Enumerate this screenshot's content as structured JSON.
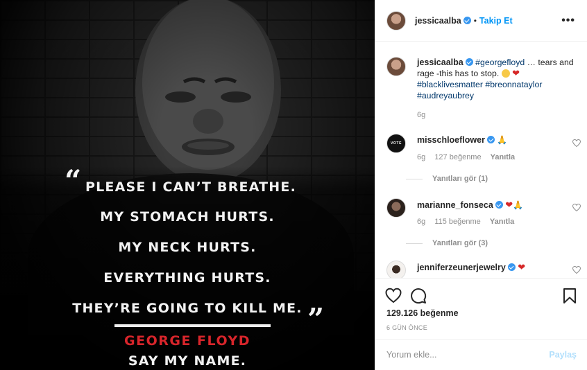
{
  "post": {
    "image": {
      "quote_lines": [
        "PLEASE I CAN’T BREATHE.",
        "MY STOMACH HURTS.",
        "MY NECK HURTS.",
        "EVERYTHING HURTS.",
        "THEY’RE GOING TO KILL ME."
      ],
      "open_quote": "“",
      "close_quote": "”",
      "name": "GEORGE FLOYD",
      "tagline": "SAY MY NAME.",
      "name_color": "#d8252b"
    }
  },
  "header": {
    "username": "jessicaalba",
    "verified": true,
    "separator": "•",
    "follow_label": "Takip Et",
    "more_icon": "more-horizontal-icon"
  },
  "caption": {
    "username": "jessicaalba",
    "hashtag1": "#georgefloyd",
    "text": " … tears and rage -this has to stop. ",
    "hashtags_line": "#blacklivesmatter #breonnataylor #audreyaubrey",
    "time": "6g"
  },
  "comments": [
    {
      "username": "misschloeflower",
      "avatar_text": "VOTE",
      "emoji": "🙏",
      "time": "6g",
      "likes": "127 beğenme",
      "reply_label": "Yanıtla",
      "replies_label": "Yanıtları gör (1)"
    },
    {
      "username": "marianne_fonseca",
      "emoji": "❤️🙏",
      "time": "6g",
      "likes": "115 beğenme",
      "reply_label": "Yanıtla",
      "replies_label": "Yanıtları gör (3)"
    },
    {
      "username": "jenniferzeunerjewelry",
      "emoji": "❤️"
    }
  ],
  "actions": {
    "icons": [
      "heart-icon",
      "comment-icon",
      "bookmark-icon"
    ],
    "likes": "129.126 beğenme",
    "time_ago": "6 GÜN ÖNCE"
  },
  "add_comment": {
    "placeholder": "Yorum ekle...",
    "share_label": "Paylaş"
  },
  "colors": {
    "link_blue": "#0095f6",
    "hashtag_blue": "#00376b",
    "verified_blue": "#3897f0",
    "share_disabled": "#b2dffc"
  }
}
